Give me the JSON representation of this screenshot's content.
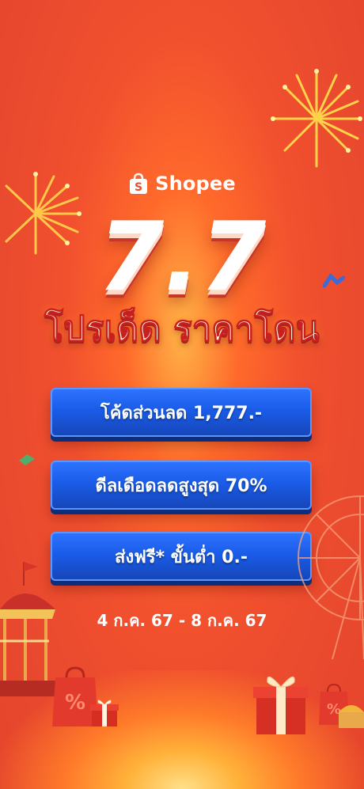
{
  "brand": {
    "name": "Shopee",
    "icon": "shopping-bag-icon"
  },
  "hero": {
    "number": "7.7",
    "subtitle": "โปรเด็ด ราคาโดน"
  },
  "buttons": [
    {
      "label": "โค้ดส่วนลด 1,777.-"
    },
    {
      "label": "ดีลเดือดลดสูงสุด 70%"
    },
    {
      "label": "ส่งฟรี* ขั้นต่ำ 0.-"
    }
  ],
  "date_range": "4 ก.ค. 67 - 8 ก.ค. 67",
  "colors": {
    "background": "#ea4a2e",
    "button": "#1a5ce8",
    "accent": "#ffd23a"
  }
}
